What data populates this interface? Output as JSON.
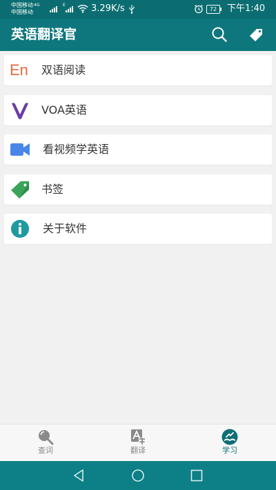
{
  "status_bar": {
    "carrier1": "中国移动",
    "carrier1_net": "4G",
    "carrier2": "中国移动",
    "signal_extra": "E",
    "speed": "3.29K/s",
    "battery": "72",
    "time": "下午1:40",
    "icons": [
      "wifi-icon",
      "usb-icon",
      "alarm-icon"
    ]
  },
  "app_bar": {
    "title": "英语翻译官",
    "icons": [
      "search-icon",
      "tag-icon"
    ]
  },
  "list": {
    "items": [
      {
        "label": "双语阅读",
        "icon": "en-text-icon",
        "icon_text": "En",
        "icon_color": "#e36a3e"
      },
      {
        "label": "VOA英语",
        "icon": "voa-v-icon",
        "icon_color": "#6a3ca8"
      },
      {
        "label": "看视频学英语",
        "icon": "video-camera-icon",
        "icon_color": "#4a86e8"
      },
      {
        "label": "书签",
        "icon": "bookmark-tag-icon",
        "icon_color": "#3aa55a"
      },
      {
        "label": "关于软件",
        "icon": "info-icon",
        "icon_color": "#1e9aa0"
      }
    ]
  },
  "bottom_nav": {
    "items": [
      {
        "label": "查词",
        "icon": "magnifier-icon",
        "active": false
      },
      {
        "label": "翻译",
        "icon": "translate-icon",
        "active": false
      },
      {
        "label": "学习",
        "icon": "study-book-icon",
        "active": true
      }
    ],
    "active_color": "#0d6f75",
    "inactive_color": "#8a8a8a"
  },
  "system_nav": {
    "icons": [
      "back-icon",
      "home-icon",
      "recents-icon"
    ]
  }
}
